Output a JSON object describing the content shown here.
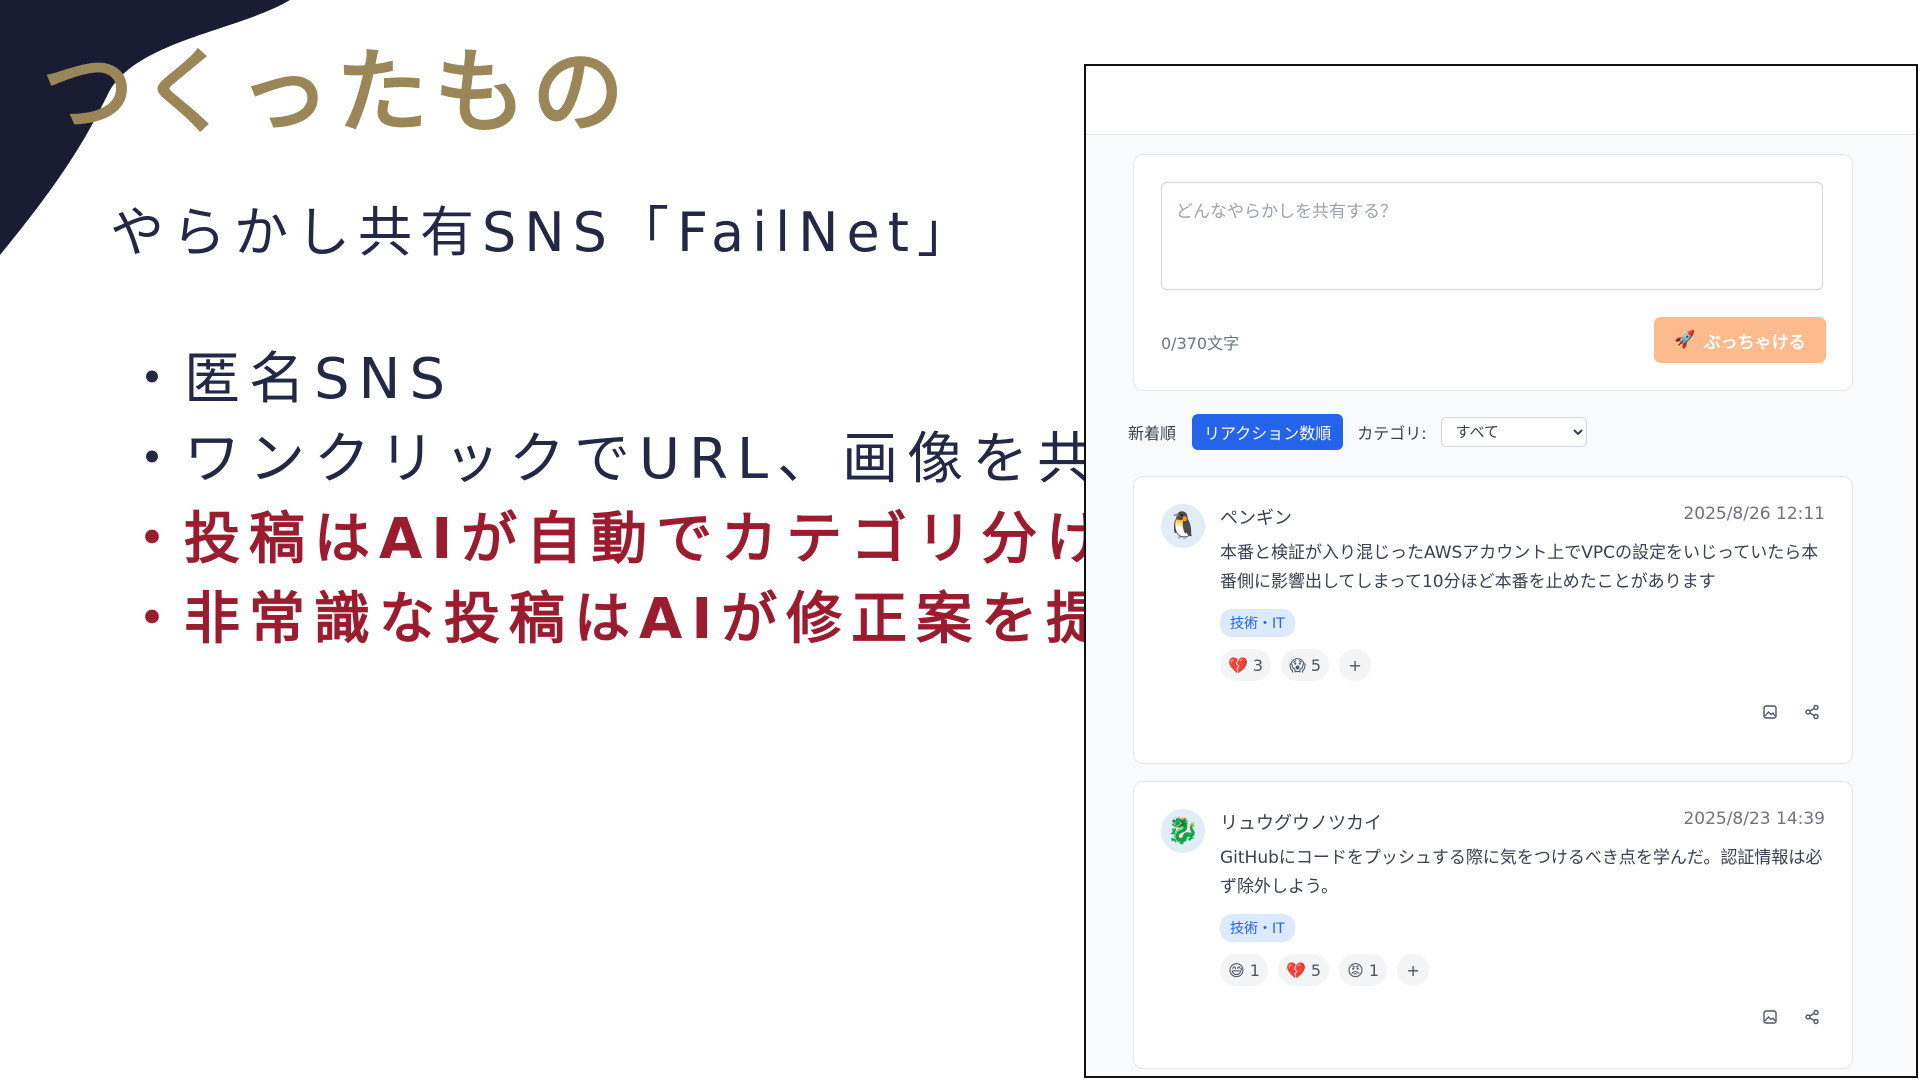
{
  "slide": {
    "title": "つくったもの",
    "subtitle": "やらかし共有SNS「FailNet」",
    "bullets": [
      "匿名SNS",
      "ワンクリックでURL、画像を共有",
      "投稿はAIが自動でカテゴリ分け",
      "非常識な投稿はAIが修正案を提示"
    ],
    "colors": {
      "title": "#9a8657",
      "text": "#232845",
      "emphasis": "#9b1c2f",
      "corner": "#1a1c33"
    }
  },
  "app": {
    "composer": {
      "placeholder": "どんなやらかしを共有する？",
      "counter": "0/370文字",
      "submit_label": "ぶっちゃける",
      "submit_icon": "rocket-icon"
    },
    "toolbar": {
      "sort_new": "新着順",
      "sort_reaction": "リアクション数順",
      "category_label": "カテゴリ:",
      "category_selected": "すべて"
    },
    "posts": [
      {
        "author": "ペンギン",
        "avatar_icon": "penguin-icon",
        "time": "2025/8/26 12:11",
        "body": "本番と検証が入り混じったAWSアカウント上でVPCの設定をいじっていたら本番側に影響出してしまって10分ほど本番を止めたことがあります",
        "tag": "技術・IT",
        "reactions": [
          {
            "emoji": "💔",
            "count": "3"
          },
          {
            "emoji": "😱",
            "count": "5"
          }
        ]
      },
      {
        "author": "リュウグウノツカイ",
        "avatar_icon": "oarfish-icon",
        "time": "2025/8/23 14:39",
        "body": "GitHubにコードをプッシュする際に気をつけるべき点を学んだ。認証情報は必ず除外しよう。",
        "tag": "技術・IT",
        "reactions": [
          {
            "emoji": "😅",
            "count": "1"
          },
          {
            "emoji": "💔",
            "count": "5"
          },
          {
            "emoji": "😡",
            "count": "1"
          }
        ]
      }
    ],
    "add_reaction": "+"
  }
}
